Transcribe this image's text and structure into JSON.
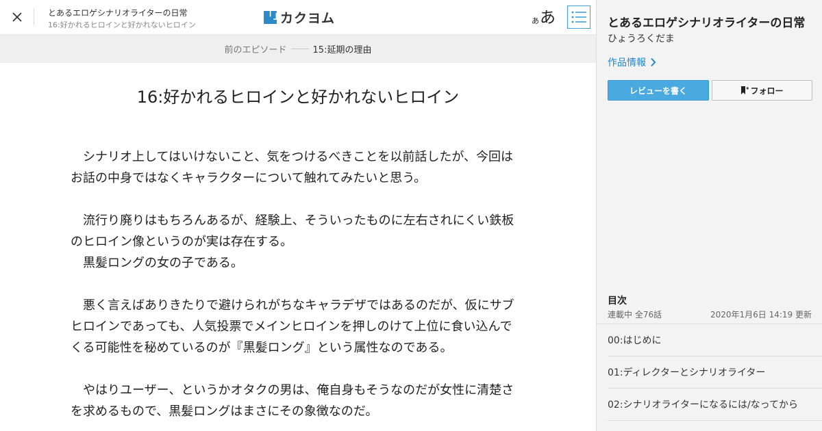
{
  "header": {
    "work_title": "とあるエロゲシナリオライターの日常",
    "episode_subtitle": "16:好かれるヒロインと好かれないヒロイン",
    "logo_mark": "「」",
    "logo_text": "カクヨム",
    "fontsize_small": "あ",
    "fontsize_large": "あ",
    "icons": {
      "close": "close-icon",
      "toc": "list-icon",
      "logo": "kakuyomu-logo-icon"
    }
  },
  "prev_episode": {
    "label": "前のエピソード",
    "title": "15:延期の理由"
  },
  "episode": {
    "heading": "16:好かれるヒロインと好かれないヒロイン",
    "paragraphs": [
      "　シナリオ上してはいけないこと、気をつけるべきことを以前話したが、今回はお話の中身ではなくキャラクターについて触れてみたいと思う。",
      "",
      "　流行り廃りはもちろんあるが、経験上、そういったものに左右されにくい鉄板のヒロイン像というのが実は存在する。",
      "　黒髪ロングの女の子である。",
      "",
      "　悪く言えばありきたりで避けられがちなキャラデザではあるのだが、仮にサブヒロインであっても、人気投票でメインヒロインを押しのけて上位に食い込んでくる可能性を秘めているのが『黒髪ロング』という属性なのである。",
      "",
      "　やはりユーザー、というかオタクの男は、俺自身もそうなのだが女性に清楚さを求めるもので、黒髪ロングはまさにその象徴なのだ。"
    ]
  },
  "sidebar": {
    "title": "とあるエロゲシナリオライターの日常",
    "author": "ひょうろくだま",
    "info_link": "作品情報",
    "review_button": "レビューを書く",
    "follow_button": "フォロー",
    "toc": {
      "heading": "目次",
      "status": "連載中 全76話",
      "updated": "2020年1月6日 14:19 更新",
      "items": [
        "00:はじめに",
        "01:ディレクターとシナリオライター",
        "02:シナリオライターになるには/なってから"
      ]
    }
  },
  "colors": {
    "accent": "#4aaae0",
    "link": "#1f87c9",
    "logo": "#2b8ac7"
  }
}
